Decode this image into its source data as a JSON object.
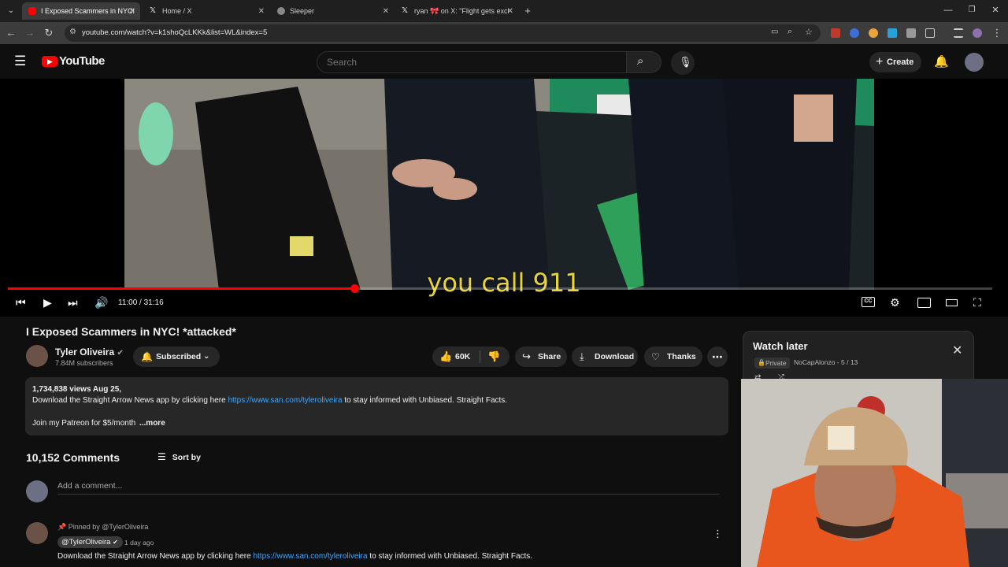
{
  "colors": {
    "accent_red": "#ff0000",
    "link_blue": "#3ea6ff",
    "subtitle_yellow": "#e8d43a"
  },
  "browser": {
    "tabs": [
      {
        "title": "I Exposed Scammers in NYC! *a",
        "icon": "youtube-icon",
        "active": true
      },
      {
        "title": "Home / X",
        "icon": "x-icon",
        "active": false
      },
      {
        "title": "Sleeper",
        "icon": "sleeper-icon",
        "active": false
      },
      {
        "title": "ryan 🎀 on X: \"Flight gets excit",
        "icon": "x-icon",
        "active": false
      }
    ],
    "url": "youtube.com/watch?v=k1shoQcLKKk&list=WL&index=5"
  },
  "youtube": {
    "logo_text": "YouTube",
    "search_placeholder": "Search",
    "create_label": "Create"
  },
  "video": {
    "subtitle": "you call 911",
    "time": "11:00 / 31:16",
    "progress": 0.352,
    "title": "I Exposed Scammers in NYC! *attacked*",
    "channel": "Tyler Oliveira",
    "subscribers": "7.84M subscribers",
    "subscribe_label": "Subscribed",
    "likes": "60K",
    "share_label": "Share",
    "download_label": "Download",
    "thanks_label": "Thanks",
    "description": {
      "meta": "1,734,838 views  Aug 25,",
      "line1_pre": "Download the Straight Arrow News app by clicking here ",
      "line1_link": "https://www.san.com/tyleroliveira",
      "line1_post": " to stay informed with Unbiased. Straight Facts.",
      "line2": "Join my Patreon for $5/month",
      "more": "...more"
    }
  },
  "comments": {
    "count": "10,152 Comments",
    "sort_label": "Sort by",
    "add_placeholder": "Add a comment...",
    "pinned": {
      "pinned_by": "Pinned by @TylerOliveira",
      "author": "@TylerOliveira",
      "date": "1 day ago",
      "text_pre": "Download the Straight Arrow News app by clicking here ",
      "text_link": "https://www.san.com/tyleroliveira",
      "text_post": " to stay informed with Unbiased. Straight Facts."
    }
  },
  "watch_later": {
    "title": "Watch later",
    "privacy": "Private",
    "meta": "NoCapAlonzo - 5 / 13"
  }
}
